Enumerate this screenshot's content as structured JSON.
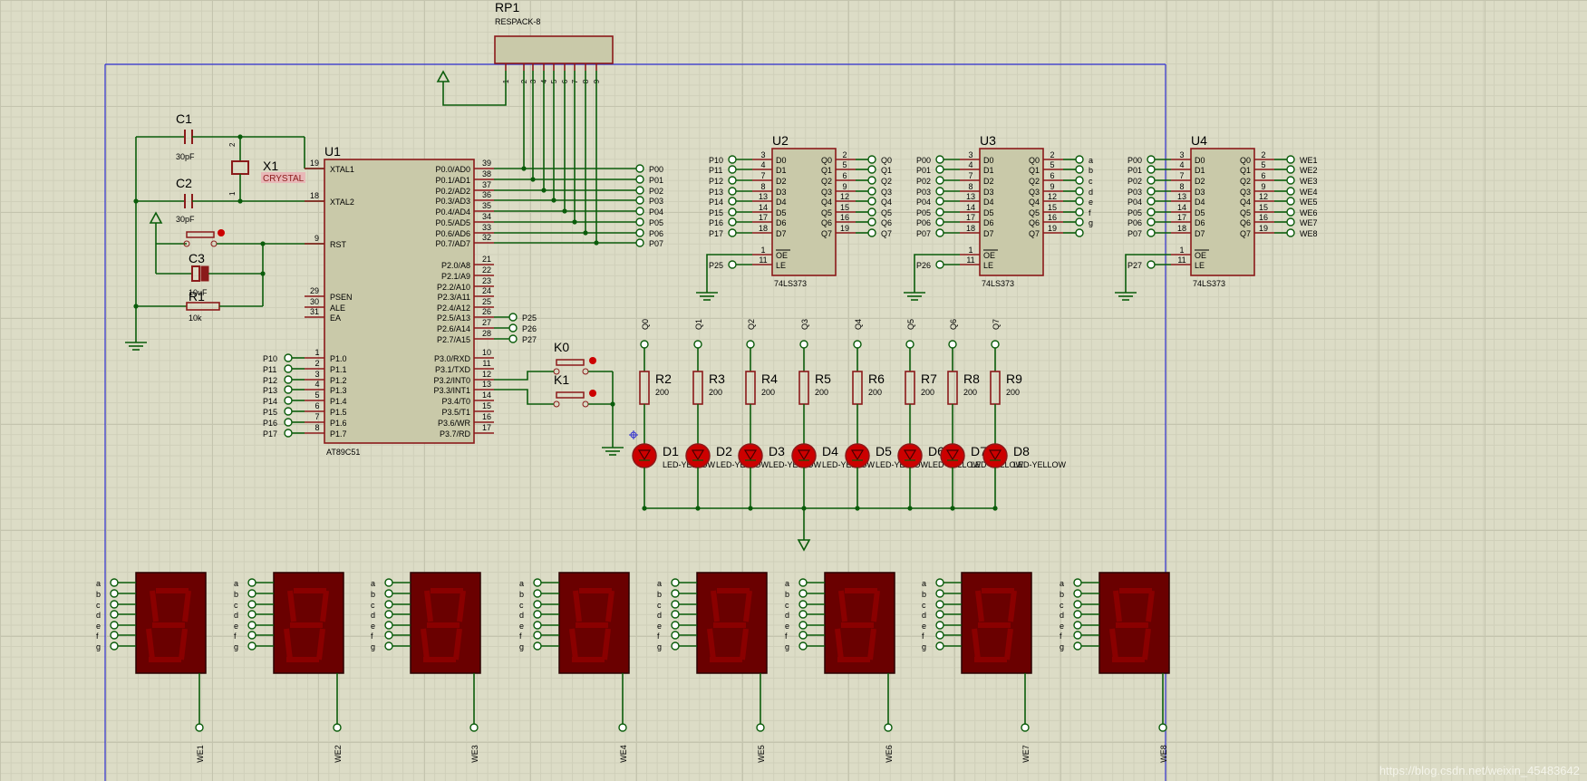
{
  "colors": {
    "wire": "#0b5c0b",
    "part": "#8b1a1a",
    "body": "#c9c9a9",
    "pin": "#8b1a1a",
    "label": "#000000",
    "led": "#cc0000",
    "seg": "#6a0000",
    "border": "#2e2ed0"
  },
  "rp1": {
    "ref": "RP1",
    "value": "RESPACK-8",
    "pins": [
      "1",
      "2",
      "3",
      "4",
      "5",
      "6",
      "7",
      "8",
      "9"
    ]
  },
  "crystal": {
    "c1": "C1",
    "c1_val": "30pF",
    "c2": "C2",
    "c2_val": "30pF",
    "x1": "X1",
    "x1_val": "CRYSTAL",
    "c3": "C3",
    "c3_val": "10uF",
    "r1": "R1",
    "r1_val": "10k",
    "pin1": "1",
    "pin2": "2"
  },
  "mcu": {
    "ref": "U1",
    "part": "AT89C51",
    "left_pins": [
      {
        "num": "19",
        "name": "XTAL1"
      },
      {
        "num": "18",
        "name": "XTAL2"
      },
      {
        "num": "9",
        "name": "RST"
      },
      {
        "num": "29",
        "name": "PSEN"
      },
      {
        "num": "30",
        "name": "ALE"
      },
      {
        "num": "31",
        "name": "EA"
      }
    ],
    "p1_pins": [
      {
        "num": "1",
        "name": "P1.0",
        "net": "P10"
      },
      {
        "num": "2",
        "name": "P1.1",
        "net": "P11"
      },
      {
        "num": "3",
        "name": "P1.2",
        "net": "P12"
      },
      {
        "num": "4",
        "name": "P1.3",
        "net": "P13"
      },
      {
        "num": "5",
        "name": "P1.4",
        "net": "P14"
      },
      {
        "num": "6",
        "name": "P1.5",
        "net": "P15"
      },
      {
        "num": "7",
        "name": "P1.6",
        "net": "P16"
      },
      {
        "num": "8",
        "name": "P1.7",
        "net": "P17"
      }
    ],
    "p0_pins": [
      {
        "num": "39",
        "name": "P0.0/AD0",
        "net": "P00"
      },
      {
        "num": "38",
        "name": "P0.1/AD1",
        "net": "P01"
      },
      {
        "num": "37",
        "name": "P0.2/AD2",
        "net": "P02"
      },
      {
        "num": "36",
        "name": "P0.3/AD3",
        "net": "P03"
      },
      {
        "num": "35",
        "name": "P0.4/AD4",
        "net": "P04"
      },
      {
        "num": "34",
        "name": "P0.5/AD5",
        "net": "P05"
      },
      {
        "num": "33",
        "name": "P0.6/AD6",
        "net": "P06"
      },
      {
        "num": "32",
        "name": "P0.7/AD7",
        "net": "P07"
      }
    ],
    "p2_pins": [
      {
        "num": "21",
        "name": "P2.0/A8",
        "net": ""
      },
      {
        "num": "22",
        "name": "P2.1/A9",
        "net": ""
      },
      {
        "num": "23",
        "name": "P2.2/A10",
        "net": ""
      },
      {
        "num": "24",
        "name": "P2.3/A11",
        "net": ""
      },
      {
        "num": "25",
        "name": "P2.4/A12",
        "net": ""
      },
      {
        "num": "26",
        "name": "P2.5/A13",
        "net": "P25"
      },
      {
        "num": "27",
        "name": "P2.6/A14",
        "net": "P26"
      },
      {
        "num": "28",
        "name": "P2.7/A15",
        "net": "P27"
      }
    ],
    "p3_pins": [
      {
        "num": "10",
        "name": "P3.0/RXD"
      },
      {
        "num": "11",
        "name": "P3.1/TXD"
      },
      {
        "num": "12",
        "name": "P3.2/INT0"
      },
      {
        "num": "13",
        "name": "P3.3/INT1"
      },
      {
        "num": "14",
        "name": "P3.4/T0"
      },
      {
        "num": "15",
        "name": "P3.5/T1"
      },
      {
        "num": "16",
        "name": "P3.6/WR"
      },
      {
        "num": "17",
        "name": "P3.7/RD"
      }
    ]
  },
  "latch_part": "74LS373",
  "latch_in_nums": [
    "3",
    "4",
    "7",
    "8",
    "13",
    "14",
    "17",
    "18"
  ],
  "latch_in_names": [
    "D0",
    "D1",
    "D2",
    "D3",
    "D4",
    "D5",
    "D6",
    "D7"
  ],
  "latch_out_nums": [
    "2",
    "5",
    "6",
    "9",
    "12",
    "15",
    "16",
    "19"
  ],
  "latch_out_names": [
    "Q0",
    "Q1",
    "Q2",
    "Q3",
    "Q4",
    "Q5",
    "Q6",
    "Q7"
  ],
  "latch_ctrl": [
    {
      "num": "1",
      "name": "OE"
    },
    {
      "num": "11",
      "name": "LE"
    }
  ],
  "latches": [
    {
      "ref": "U2",
      "inputs": [
        "P10",
        "P11",
        "P12",
        "P13",
        "P14",
        "P15",
        "P16",
        "P17"
      ],
      "outputs": [
        "Q0",
        "Q1",
        "Q2",
        "Q3",
        "Q4",
        "Q5",
        "Q6",
        "Q7"
      ],
      "le_net": "P25"
    },
    {
      "ref": "U3",
      "inputs": [
        "P00",
        "P01",
        "P02",
        "P03",
        "P04",
        "P05",
        "P06",
        "P07"
      ],
      "outputs": [
        "a",
        "b",
        "c",
        "d",
        "e",
        "f",
        "g",
        ""
      ],
      "le_net": "P26"
    },
    {
      "ref": "U4",
      "inputs": [
        "P00",
        "P01",
        "P02",
        "P03",
        "P04",
        "P05",
        "P06",
        "P07"
      ],
      "outputs": [
        "WE1",
        "WE2",
        "WE3",
        "WE4",
        "WE5",
        "WE6",
        "WE7",
        "WE8"
      ],
      "le_net": "P27"
    }
  ],
  "keys": [
    {
      "ref": "K0"
    },
    {
      "ref": "K1"
    }
  ],
  "leds": [
    {
      "net": "Q0",
      "r": "R2",
      "rv": "200",
      "d": "D1",
      "dv": "LED-YELLOW"
    },
    {
      "net": "Q1",
      "r": "R3",
      "rv": "200",
      "d": "D2",
      "dv": "LED-YELLOW"
    },
    {
      "net": "Q2",
      "r": "R4",
      "rv": "200",
      "d": "D3",
      "dv": "LED-YELLOW"
    },
    {
      "net": "Q3",
      "r": "R5",
      "rv": "200",
      "d": "D4",
      "dv": "LED-YELLOW"
    },
    {
      "net": "Q4",
      "r": "R6",
      "rv": "200",
      "d": "D5",
      "dv": "LED-YELLOW"
    },
    {
      "net": "Q5",
      "r": "R7",
      "rv": "200",
      "d": "D6",
      "dv": "LED-YELLOW"
    },
    {
      "net": "Q6",
      "r": "R8",
      "rv": "200",
      "d": "D7",
      "dv": "LED-YELLOW"
    },
    {
      "net": "Q7",
      "r": "R9",
      "rv": "200",
      "d": "D8",
      "dv": "LED-YELLOW"
    }
  ],
  "seg_pins": [
    "a",
    "b",
    "c",
    "d",
    "e",
    "f",
    "g"
  ],
  "displays": [
    "WE1",
    "WE2",
    "WE3",
    "WE4",
    "WE5",
    "WE6",
    "WE7",
    "WE8"
  ],
  "watermark": "https://blog.csdn.net/weixin_45483642"
}
